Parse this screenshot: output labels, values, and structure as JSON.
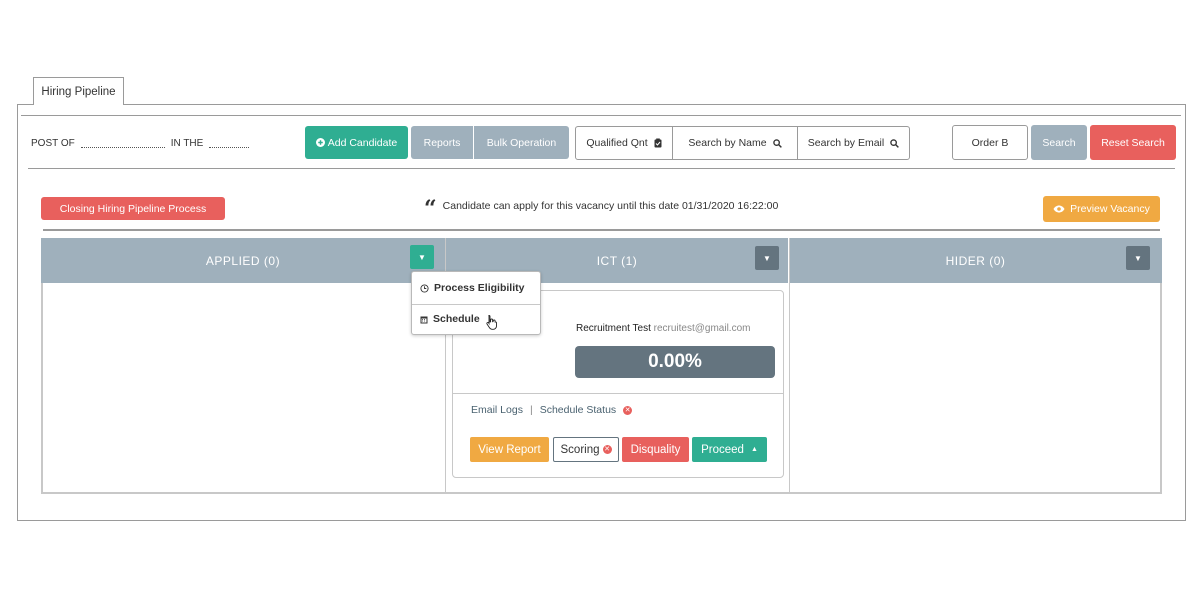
{
  "tab": {
    "label": "Hiring Pipeline"
  },
  "header": {
    "post_of": "POST OF",
    "in_the": "IN THE"
  },
  "toolbar": {
    "add_candidate": "Add Candidate",
    "reports": "Reports",
    "bulk_operation": "Bulk Operation",
    "qualified_qnt": "Qualified Qnt",
    "search_by_name": "Search by Name",
    "search_by_email": "Search by Email",
    "order": "Order B",
    "search": "Search",
    "reset_search": "Reset Search"
  },
  "banner": {
    "closing_button": "Closing Hiring Pipeline Process",
    "notice": "Candidate can apply for this vacancy until this date 01/31/2020 16:22:00",
    "preview_button": "Preview Vacancy"
  },
  "columns": [
    {
      "label": "APPLIED  (0)"
    },
    {
      "label": "ICT  (1)"
    },
    {
      "label": "HIDER  (0)"
    }
  ],
  "dropdown_menu": {
    "items": [
      {
        "label": "Process Eligibility",
        "icon": "clock-icon"
      },
      {
        "label": "Schedule",
        "icon": "calendar-icon"
      }
    ]
  },
  "candidate_card": {
    "name": "Recruitment Test",
    "email": "recruitest@gmail.com",
    "score": "0.00%",
    "email_logs": "Email Logs",
    "separator": "|",
    "schedule_status": "Schedule Status",
    "view_report": "View Report",
    "scoring": "Scoring",
    "disqualify": "Disquality",
    "proceed": "Proceed"
  },
  "colors": {
    "teal": "#2fae92",
    "slate": "#9fb0bc",
    "dark_slate": "#64747f",
    "red": "#e8605d",
    "orange": "#f0a942"
  }
}
